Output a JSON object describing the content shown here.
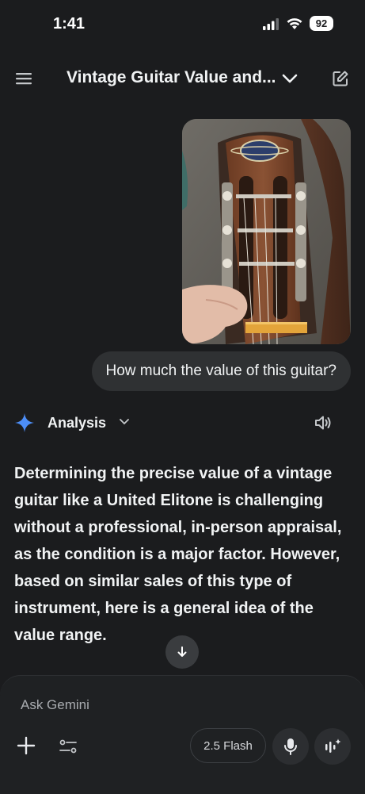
{
  "status": {
    "time": "1:41",
    "battery": "92"
  },
  "header": {
    "title": "Vintage Guitar Value and..."
  },
  "conversation": {
    "user_image_brand": "UNITED ELITONE",
    "user_message": "How much the value of this guitar?"
  },
  "response": {
    "mode_label": "Analysis",
    "p1_a": "Determining the precise value of a vintage guitar like a ",
    "p1_b": "United Elitone",
    "p1_c": " is challenging without a professional, in-person appraisal, as the ",
    "p1_d": "condition",
    "p1_e": " is a major factor. However, based on similar sales of this type of instrument, here is a general idea of the value range."
  },
  "composer": {
    "placeholder": "Ask Gemini",
    "model_label": "2.5 Flash"
  },
  "colors": {
    "background": "#1b1c1e",
    "bubble": "#2f3133",
    "accent_spark": "#4c8df6"
  },
  "icons": [
    "menu-icon",
    "chevron-down-icon",
    "edit-icon",
    "sparkle-icon",
    "speaker-icon",
    "arrow-down-icon",
    "plus-icon",
    "tune-icon",
    "mic-icon",
    "live-icon",
    "signal-icon",
    "wifi-icon"
  ]
}
